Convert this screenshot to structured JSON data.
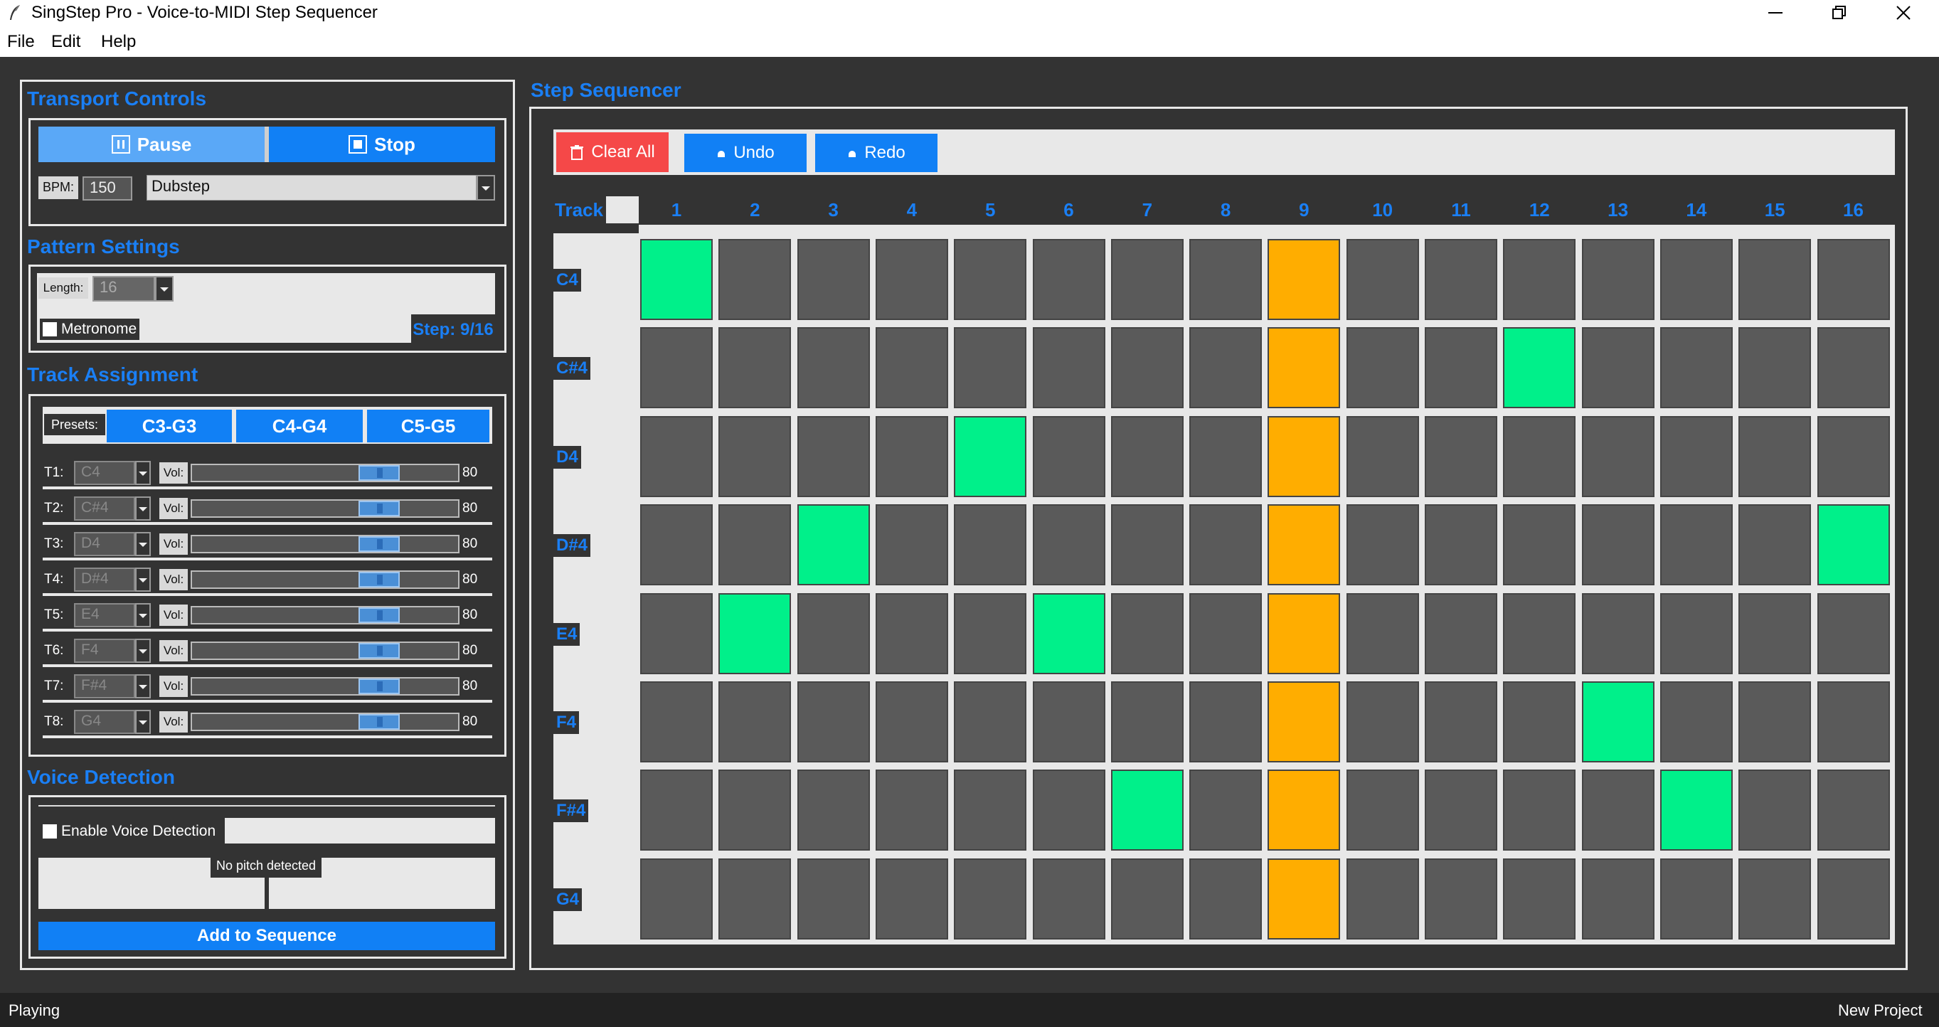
{
  "window": {
    "title": "SingStep Pro - Voice-to-MIDI Step Sequencer",
    "menus": [
      "File",
      "Edit",
      "Help"
    ]
  },
  "transport": {
    "title": "Transport Controls",
    "pause_label": "Pause",
    "stop_label": "Stop",
    "bpm_label": "BPM:",
    "bpm_value": "150",
    "style_value": "Dubstep"
  },
  "pattern": {
    "title": "Pattern Settings",
    "length_label": "Length:",
    "length_value": "16",
    "metronome_label": "Metronome",
    "metronome_checked": false,
    "step_text": "Step: 9/16"
  },
  "tracks": {
    "title": "Track Assignment",
    "presets_label": "Presets:",
    "presets": [
      "C3-G3",
      "C4-G4",
      "C5-G5"
    ],
    "vol_label": "Vol:",
    "rows": [
      {
        "label": "T1:",
        "note": "C4",
        "vol": "80",
        "level": 0.8
      },
      {
        "label": "T2:",
        "note": "C#4",
        "vol": "80",
        "level": 0.8
      },
      {
        "label": "T3:",
        "note": "D4",
        "vol": "80",
        "level": 0.8
      },
      {
        "label": "T4:",
        "note": "D#4",
        "vol": "80",
        "level": 0.8
      },
      {
        "label": "T5:",
        "note": "E4",
        "vol": "80",
        "level": 0.8
      },
      {
        "label": "T6:",
        "note": "F4",
        "vol": "80",
        "level": 0.8
      },
      {
        "label": "T7:",
        "note": "F#4",
        "vol": "80",
        "level": 0.8
      },
      {
        "label": "T8:",
        "note": "G4",
        "vol": "80",
        "level": 0.8
      }
    ]
  },
  "voice": {
    "title": "Voice Detection",
    "enable_label": "Enable Voice Detection",
    "enable_checked": false,
    "pitch_text": "No pitch detected",
    "add_label": "Add to Sequence"
  },
  "sequencer": {
    "title": "Step Sequencer",
    "clear_label": "Clear All",
    "undo_label": "Undo",
    "redo_label": "Redo",
    "track_header": "Track",
    "steps": [
      "1",
      "2",
      "3",
      "4",
      "5",
      "6",
      "7",
      "8",
      "9",
      "10",
      "11",
      "12",
      "13",
      "14",
      "15",
      "16"
    ],
    "row_labels": [
      "C4",
      "C#4",
      "D4",
      "D#4",
      "E4",
      "F4",
      "F#4",
      "G4"
    ],
    "current_step": 9,
    "active": [
      [
        1
      ],
      [
        12
      ],
      [
        5
      ],
      [
        3,
        16
      ],
      [
        2,
        6
      ],
      [
        13
      ],
      [
        7,
        14
      ],
      []
    ],
    "colors": {
      "active": "#00f08a",
      "current": "#ffad00",
      "off": "#5a5a5a",
      "accent": "#1180f5",
      "clear": "#f54848"
    }
  },
  "status": {
    "left": "Playing",
    "right": "New Project"
  }
}
